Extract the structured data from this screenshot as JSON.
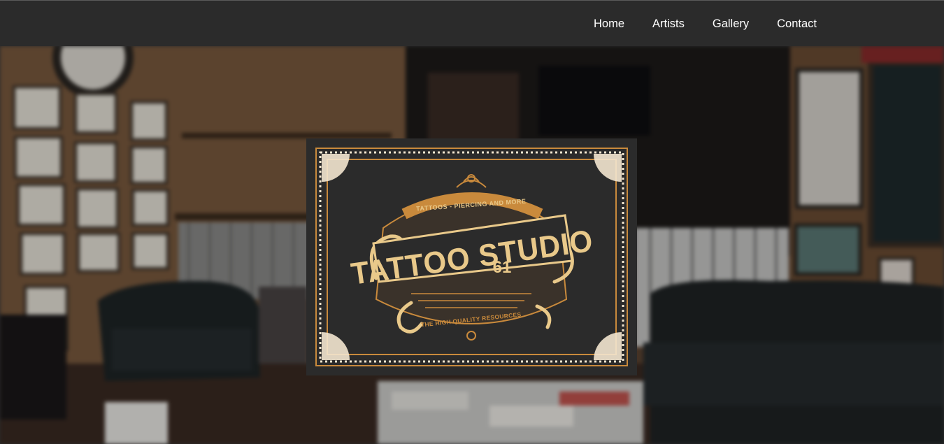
{
  "nav": {
    "items": [
      {
        "label": "Home"
      },
      {
        "label": "Artists"
      },
      {
        "label": "Gallery"
      },
      {
        "label": "Contact"
      }
    ]
  },
  "logo": {
    "tagline_top": "TATTOOS - PIERCING AND MORE",
    "title": "TATTOO STUDIO",
    "number": "61",
    "tagline_bottom": "THE HIGH QUALITY RESOURCES"
  },
  "colors": {
    "navbar": "#2b2b2b",
    "nav_text": "#ffffff",
    "logo_gold": "#e9c98a",
    "logo_copper": "#c98a3c",
    "logo_bg": "#2b2b2b"
  }
}
